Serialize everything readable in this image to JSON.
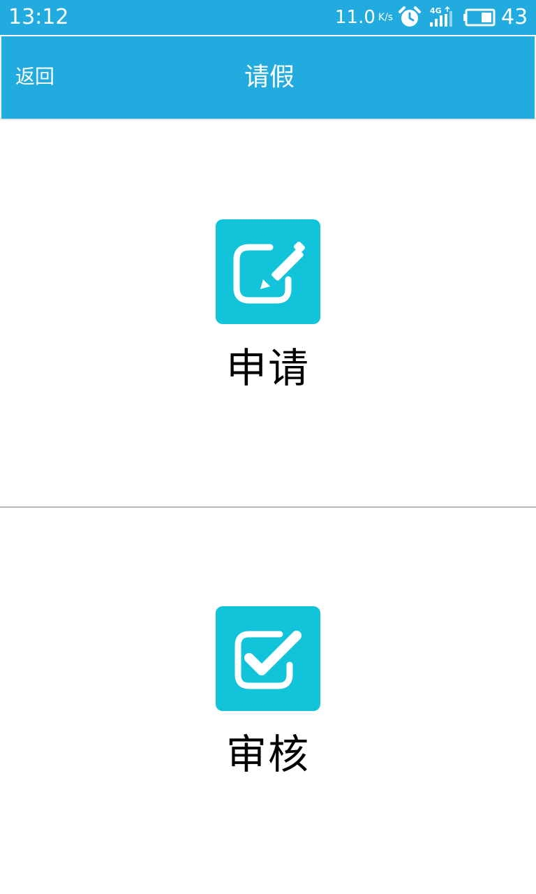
{
  "status_bar": {
    "time": "13:12",
    "net_speed": "11.0",
    "net_speed_unit": "K/s",
    "network_type": "4G",
    "battery_level": "43",
    "icons": [
      "alarm-icon",
      "signal-icon",
      "battery-icon"
    ]
  },
  "app_bar": {
    "back_label": "返回",
    "title": "请假"
  },
  "menu": {
    "items": [
      {
        "label": "申请",
        "icon": "edit-icon"
      },
      {
        "label": "审核",
        "icon": "checkbox-icon"
      }
    ]
  },
  "colors": {
    "primary": "#22ABDE",
    "tile": "#12C4DA",
    "divider": "#B8B8B8"
  }
}
